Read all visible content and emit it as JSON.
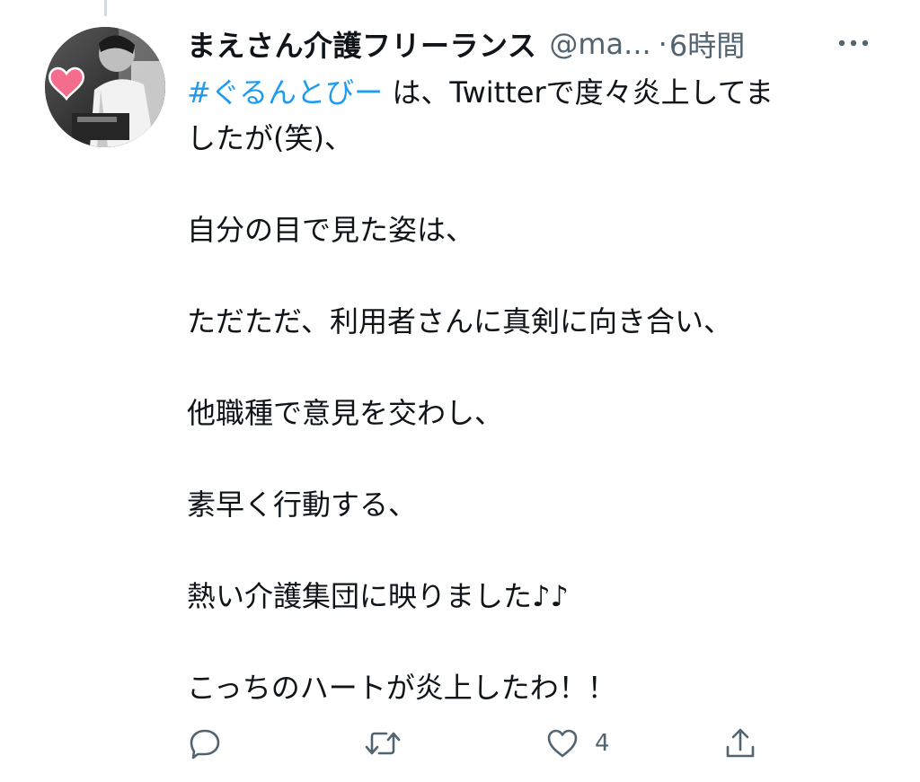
{
  "tweet": {
    "author_name": "まえさん介護フリーランス",
    "handle": "@ma...",
    "separator": "·",
    "time": "6時間",
    "hashtag": "#ぐるんとびー",
    "line1_rest": " は、Twitterで度々炎上してま",
    "line2": "したが(笑)、",
    "line3": "自分の目で見た姿は、",
    "line4": "ただただ、利用者さんに真剣に向き合い、",
    "line5": "他職種で意見を交わし、",
    "line6": "素早く行動する、",
    "line7": "熱い介護集団に映りました♪♪",
    "line8": "こっちのハートが炎上したわ！！"
  },
  "actions": {
    "like_count": "4"
  },
  "icons": {
    "reply": "speech-bubble-icon",
    "retweet": "retweet-arrows-icon",
    "like": "heart-icon",
    "share": "share-upload-icon",
    "more": "three-dots-icon",
    "avatar_badge": "pink-heart-icon"
  },
  "colors": {
    "hashtag": "#1d9bf0",
    "secondary_text": "#536471",
    "primary_text": "#0f1419",
    "avatar_heart": "#f46d8c"
  }
}
